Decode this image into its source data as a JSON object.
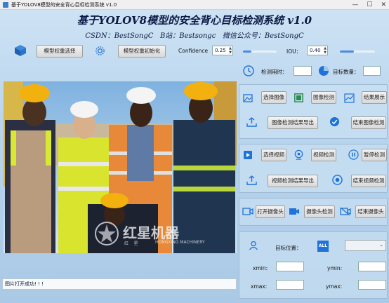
{
  "window": {
    "title": "基于YOLOV8模型的安全背心目标检测系统 v1.0",
    "controls": [
      "—",
      "☐",
      "✕"
    ]
  },
  "header": {
    "title": "基于YOLOV8模型的安全背心目标检测系统 v1.0",
    "subtitle": "CSDN：BestSongC   B站：Bestsongc   微信公众号：BestSongC"
  },
  "toolbar": {
    "model_select_label": "模型权重选择",
    "model_init_label": "模型权重初始化",
    "confidence_label": "Confidence",
    "confidence_value": "0.25",
    "confidence_level": 0.25,
    "iou_label": "IOU：",
    "iou_value": "0.40",
    "iou_level": 0.4
  },
  "image_view": {
    "watermark_brand": "红星机器",
    "watermark_small": "红    星",
    "watermark_en": "HONGXING MACHINERY"
  },
  "status_bar": {
    "text": "图片打开成功! ! !"
  },
  "stats": {
    "time_label": "检测用时：",
    "time_value": "",
    "count_label": "目标数量：",
    "count_value": ""
  },
  "image_panel": {
    "select_label": "选择图像",
    "detect_label": "图像检测",
    "show_label": "结果展示",
    "export_label": "图像检测结果导出",
    "end_label": "结束图像检测"
  },
  "video_panel": {
    "select_label": "选择视频",
    "detect_label": "视频检测",
    "pause_label": "暂停检测",
    "export_label": "视频检测结果导出",
    "end_label": "结束视频检测"
  },
  "camera_panel": {
    "open_label": "打开摄像头",
    "detect_label": "摄像头检测",
    "close_label": "结束摄像头"
  },
  "target_panel": {
    "pos_label": "目标位置：",
    "all_badge": "ALL",
    "select_value": "",
    "xmin_label": "xmin:",
    "ymin_label": "ymin:",
    "xmax_label": "xmax:",
    "ymax_label": "ymax:",
    "xmin_value": "",
    "ymin_value": "",
    "xmax_value": "",
    "ymax_value": ""
  },
  "colors": {
    "accent": "#1e72d8",
    "title_text": "#0b1a44",
    "vest_yellow": "#d9e832",
    "vest_orange": "#e8893a",
    "hat_yellow": "#f2b10f"
  }
}
